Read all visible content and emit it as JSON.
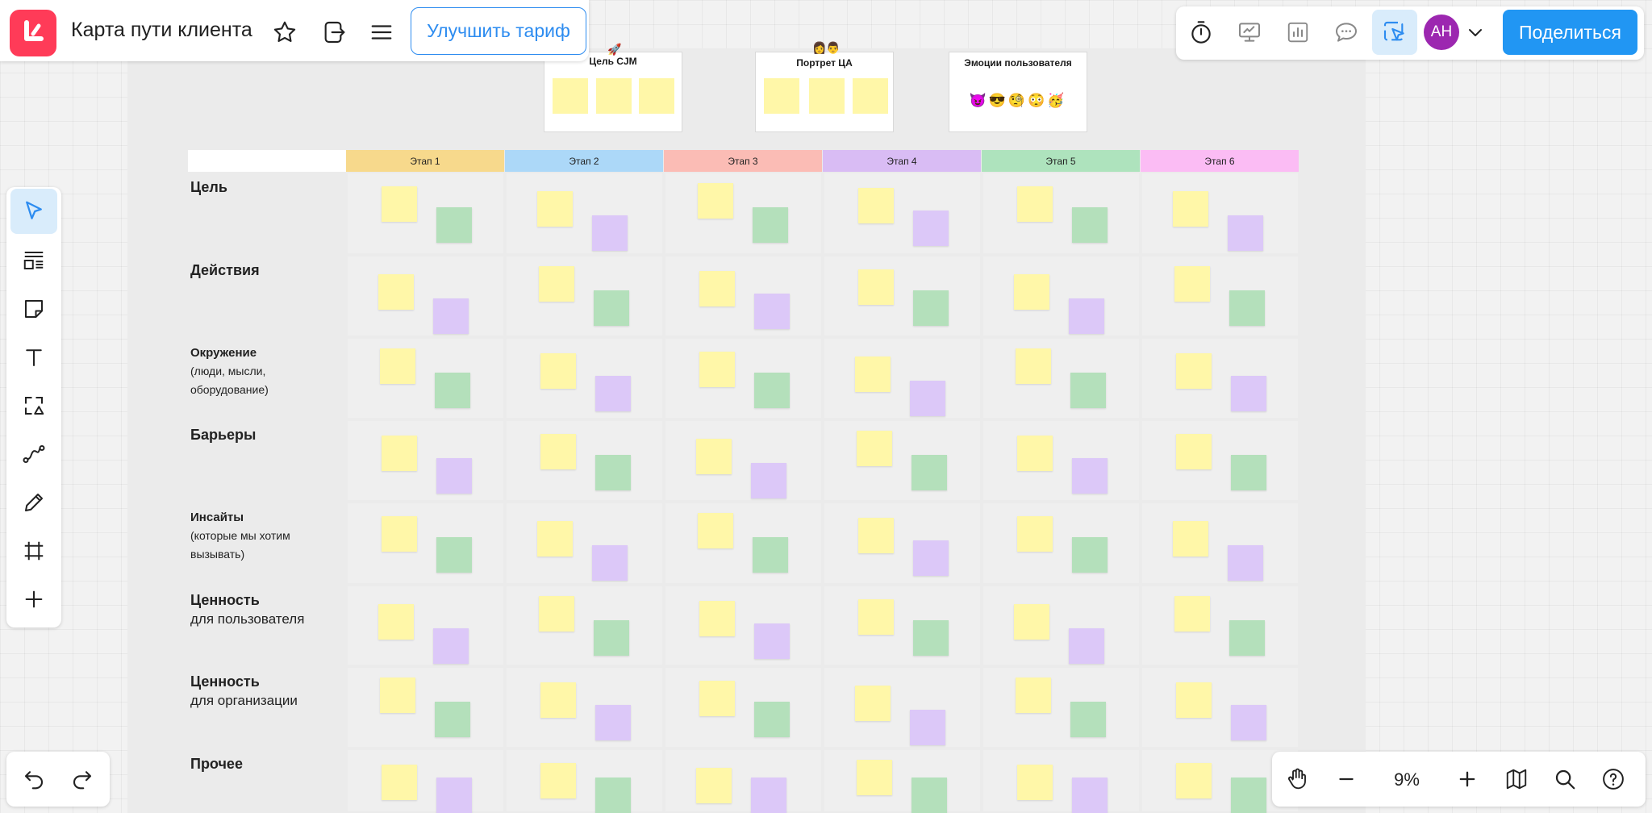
{
  "app": {
    "board_title": "Карта пути клиента",
    "upgrade_label": "Улучшить тариф",
    "share_label": "Поделиться",
    "avatar_initials": "АН",
    "zoom_label": "9%"
  },
  "colors": {
    "brand": "#ff3b58",
    "accent": "#2196f3",
    "avatar": "#9c27b0",
    "sticky_yellow": "#fff7a8",
    "sticky_green": "#b4e0bb",
    "sticky_purple": "#dcc8f8"
  },
  "top_left_icons": [
    "logo-icon",
    "star-icon",
    "export-icon",
    "menu-icon"
  ],
  "top_right_icons": [
    "timer-icon",
    "presentation-icon",
    "voting-icon",
    "comments-icon",
    "collaborator-cursor-icon",
    "chevron-down-icon"
  ],
  "left_tools": [
    "select-tool",
    "templates-tool",
    "sticky-note-tool",
    "text-tool",
    "shapes-tool",
    "connector-tool",
    "pen-tool",
    "frame-tool",
    "add-tool"
  ],
  "bottom_left": [
    "undo-icon",
    "redo-icon"
  ],
  "bottom_right": [
    "hand-icon",
    "zoom-out-icon",
    "zoom-in-icon",
    "map-icon",
    "search-icon",
    "help-icon"
  ],
  "cards": [
    {
      "title": "Цель CJM",
      "emoji": "🚀",
      "stickies": 3
    },
    {
      "title": "Портрет ЦА",
      "emoji": "👩👨",
      "stickies": 3
    },
    {
      "title": "Эмоции пользователя",
      "emojis": "😈😎🧐😳🥳"
    }
  ],
  "stages": [
    {
      "label": "Этап 1",
      "color": "#f7d98c"
    },
    {
      "label": "Этап 2",
      "color": "#acd8f8"
    },
    {
      "label": "Этап 3",
      "color": "#fbbcb5"
    },
    {
      "label": "Этап 4",
      "color": "#d9bcf4"
    },
    {
      "label": "Этап 5",
      "color": "#aee3bd"
    },
    {
      "label": "Этап 6",
      "color": "#fbbcf4"
    }
  ],
  "rows": [
    {
      "title": "Цель",
      "sub": ""
    },
    {
      "title": "Действия",
      "sub": ""
    },
    {
      "title": "Окружение",
      "sub": "(люди, мысли, оборудование)"
    },
    {
      "title": "Барьеры",
      "sub": ""
    },
    {
      "title": "Инсайты",
      "sub": "(которые мы хотим вызывать)"
    },
    {
      "title": "Ценность",
      "sub": "для пользователя"
    },
    {
      "title": "Ценность",
      "sub": "для организации"
    },
    {
      "title": "Прочее",
      "sub": ""
    }
  ],
  "second_sticky_colors": [
    [
      "green",
      "purple",
      "green",
      "purple",
      "green",
      "purple"
    ],
    [
      "purple",
      "green",
      "purple",
      "green",
      "purple",
      "green"
    ],
    [
      "green",
      "purple",
      "green",
      "purple",
      "green",
      "purple"
    ],
    [
      "purple",
      "green",
      "purple",
      "green",
      "purple",
      "green"
    ],
    [
      "green",
      "purple",
      "green",
      "purple",
      "green",
      "purple"
    ],
    [
      "purple",
      "green",
      "purple",
      "green",
      "purple",
      "green"
    ],
    [
      "green",
      "purple",
      "green",
      "purple",
      "green",
      "purple"
    ],
    [
      "purple",
      "green",
      "purple",
      "green",
      "purple",
      "green"
    ]
  ]
}
